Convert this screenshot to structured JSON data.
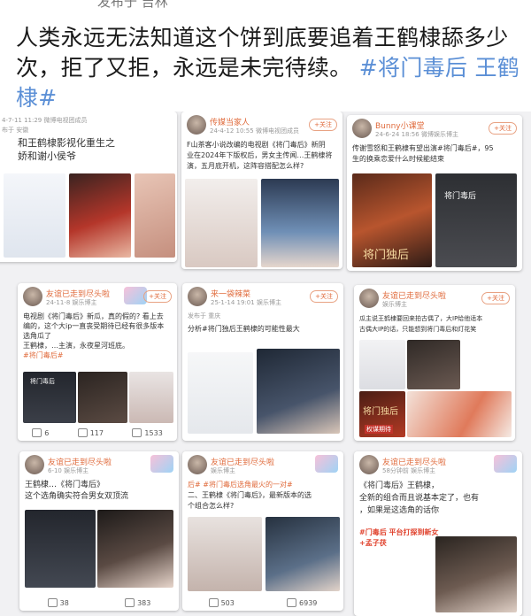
{
  "top_strip": "发布于 吉林",
  "headline": {
    "text": "人类永远无法知道这个饼到底要追着王鹤棣舔多少次，拒了又拒，永远是未完待续。",
    "tag1": "#将门毒后",
    "tag2": "王鹤棣#"
  },
  "cards": [
    {
      "meta": "4-7-11 11:29  微博电视团成员",
      "meta2": "布于 安徽",
      "text": "和王鹤棣影视化重生之",
      "text2": "娇和谢小侯爷"
    },
    {
      "user": "传媒当家人",
      "meta": "24-4-12 10:55  微博电视团成员",
      "follow": "+关注",
      "text": "F山茶客小说改编的电视剧《将门毒后》新阴",
      "text2": "业在2024年下版权后，男女主传闻…王鹤棣将",
      "text3": "演，五月底开机，这阵容搭配怎么样?"
    },
    {
      "user": "Bunny小课堂",
      "meta": "24-6-24 18:56  微博娱乐博主",
      "follow": "+关注",
      "text": "传谢雪怒和王鹤棣有望出演#将门毒后#，95",
      "text2": "生的换乘恋爱什么时候能结束",
      "poster_title": "将门毒后",
      "poster_sub": "将门独后"
    },
    {
      "user": "友谊已走到尽头啦",
      "meta": "24-11-8  娱乐博主",
      "follow": "+关注",
      "text": "电视剧《将门毒后》新瓜，真的假的? 看上去",
      "text2": "编的，这个大ip一直丧受期待已经有很多版本",
      "text3": "选角瓜了",
      "text4": "王鹤棣，…主演，永夜星河班底。",
      "text5": "#将门毒后#",
      "poster": "将门毒后",
      "likes": "6",
      "comments": "117",
      "reposts": "1533"
    },
    {
      "user": "来一袋辣菜",
      "meta": "25-1-14 19:01  娱乐博主",
      "meta2": "发布于 重庆",
      "follow": "+关注",
      "text": "分析#将门独后王鹤棣的可能性最大"
    },
    {
      "user": "友谊已走到尽头啦",
      "meta": "娱乐博主",
      "follow": "+关注",
      "text": "瓜主说王鹤棣要回来拍古偶了，大IP给他适本",
      "text2": "古偶大IP的话，只能想到将门毒后和灯花笑",
      "poster": "将门独后",
      "poster_sub": "权谋期待"
    },
    {
      "user": "友谊已走到尽头啦",
      "meta": "6-10  娱乐博主",
      "text": "王鹤棣…《将门毒后》",
      "text2": "这个选角确实符合男女双顶流",
      "likes": "38",
      "comments": "383"
    },
    {
      "user": "友谊已走到尽头啦",
      "meta": "娱乐博主",
      "text": "后#  #将门毒后选角最火的一对#",
      "text2": "二、王鹤棣《将门毒后》，最新版本的选",
      "text3": "个组合怎么样?",
      "likes": "503",
      "comments": "6939"
    },
    {
      "user": "友谊已走到尽头啦",
      "meta": "58分钟前  娱乐博主",
      "text": "《将门毒后》王鹤棣，",
      "text2": "全新的组合而且说基本定了，也有",
      "text3": "，如果是这选角的话你",
      "tag": "#门毒后 平台打探到新女",
      "tag2": "+孟子茯"
    }
  ],
  "colors": {
    "accent": "#e06b3c",
    "tag": "#5b8fd6"
  }
}
